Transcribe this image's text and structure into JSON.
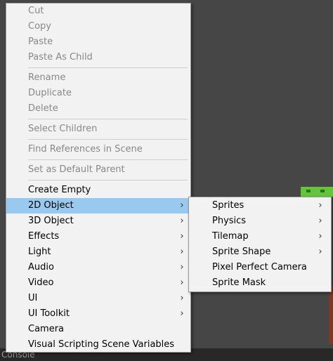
{
  "console": {
    "label": "Console"
  },
  "menu": {
    "items": [
      {
        "label": "Cut",
        "enabled": false
      },
      {
        "label": "Copy",
        "enabled": false
      },
      {
        "label": "Paste",
        "enabled": false
      },
      {
        "label": "Paste As Child",
        "enabled": false
      },
      {
        "label": "Rename",
        "enabled": false
      },
      {
        "label": "Duplicate",
        "enabled": false
      },
      {
        "label": "Delete",
        "enabled": false
      },
      {
        "label": "Select Children",
        "enabled": false
      },
      {
        "label": "Find References in Scene",
        "enabled": false
      },
      {
        "label": "Set as Default Parent",
        "enabled": false
      },
      {
        "label": "Create Empty",
        "enabled": true
      },
      {
        "label": "2D Object",
        "enabled": true,
        "submenu": true,
        "highlighted": true
      },
      {
        "label": "3D Object",
        "enabled": true,
        "submenu": true
      },
      {
        "label": "Effects",
        "enabled": true,
        "submenu": true
      },
      {
        "label": "Light",
        "enabled": true,
        "submenu": true
      },
      {
        "label": "Audio",
        "enabled": true,
        "submenu": true
      },
      {
        "label": "Video",
        "enabled": true,
        "submenu": true
      },
      {
        "label": "UI",
        "enabled": true,
        "submenu": true
      },
      {
        "label": "UI Toolkit",
        "enabled": true,
        "submenu": true
      },
      {
        "label": "Camera",
        "enabled": true
      },
      {
        "label": "Visual Scripting Scene Variables",
        "enabled": true
      }
    ]
  },
  "submenu": {
    "items": [
      {
        "label": "Sprites",
        "submenu": true
      },
      {
        "label": "Physics",
        "submenu": true
      },
      {
        "label": "Tilemap",
        "submenu": true
      },
      {
        "label": "Sprite Shape",
        "submenu": true
      },
      {
        "label": "Pixel Perfect Camera"
      },
      {
        "label": "Sprite Mask"
      }
    ]
  },
  "chevron_glyph": "›",
  "colors": {
    "highlight": "#99c9ef",
    "menu_bg": "#f2f2f2",
    "disabled_text": "#888888"
  }
}
